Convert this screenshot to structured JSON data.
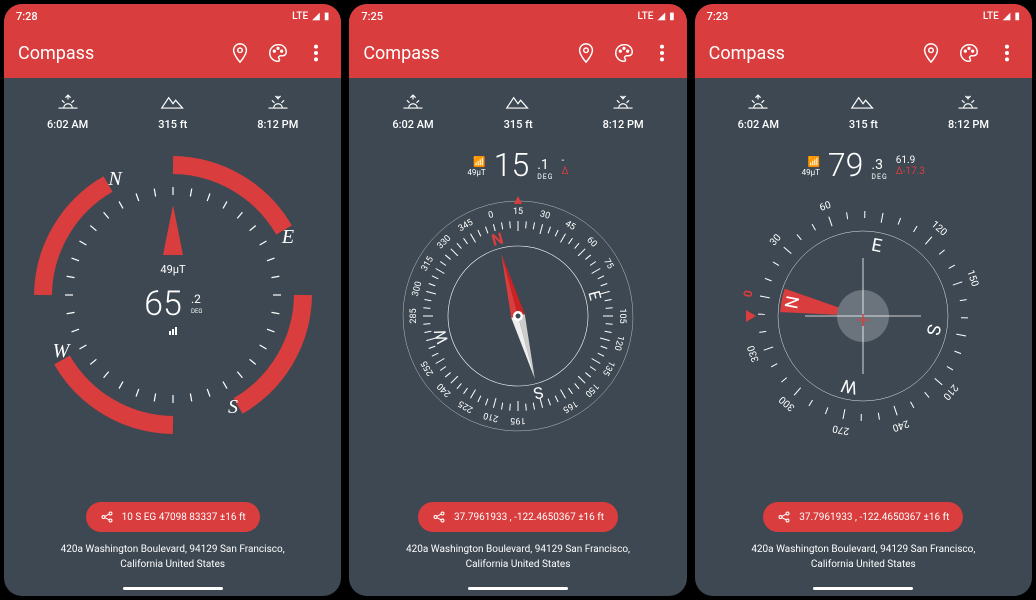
{
  "screens": [
    {
      "status_time": "7:28",
      "lte": "LTE",
      "app_title": "Compass",
      "info": {
        "sunrise": "6:02 AM",
        "altitude": "315 ft",
        "sunset": "8:12 PM"
      },
      "field_strength": "49μT",
      "heading_int": "65",
      "heading_dec": ".2",
      "heading_unit": "DEG",
      "coords": "10 S EG 47098 83337 ±16 ft",
      "address_l1": "420a Washington Boulevard, 94129 San Francisco,",
      "address_l2": "California United States"
    },
    {
      "status_time": "7:25",
      "lte": "LTE",
      "app_title": "Compass",
      "info": {
        "sunrise": "6:02 AM",
        "altitude": "315 ft",
        "sunset": "8:12 PM"
      },
      "field_strength": "49μT",
      "heading_int": "15",
      "heading_dec": ".1",
      "heading_unit": "DEG",
      "right_v1": "-",
      "right_v2": "Δ",
      "coords": "37.7961933 , -122.4650367 ±16 ft",
      "address_l1": "420a Washington Boulevard, 94129 San Francisco,",
      "address_l2": "California United States"
    },
    {
      "status_time": "7:23",
      "lte": "LTE",
      "app_title": "Compass",
      "info": {
        "sunrise": "6:02 AM",
        "altitude": "315 ft",
        "sunset": "8:12 PM"
      },
      "field_strength": "49μT",
      "heading_int": "79",
      "heading_dec": ".3",
      "heading_unit": "DEG",
      "right_v1": "61.9",
      "right_v2": "Δ-17.3",
      "coords": "37.7961933 , -122.4650367 ±16 ft",
      "address_l1": "420a Washington Boulevard, 94129 San Francisco,",
      "address_l2": "California United States"
    }
  ]
}
